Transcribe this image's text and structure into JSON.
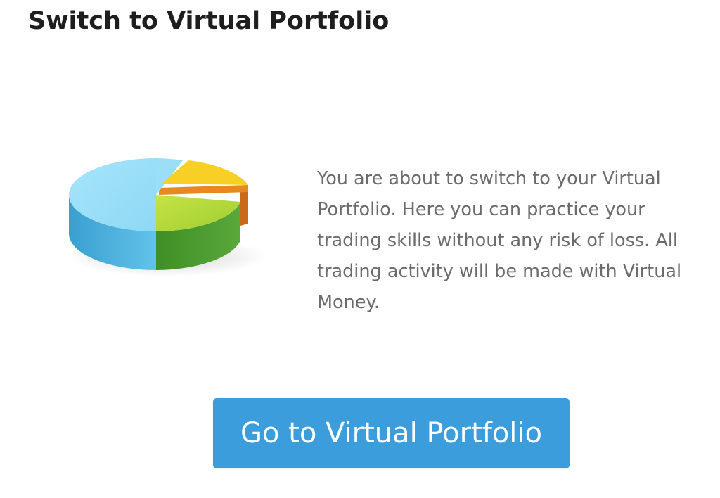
{
  "dialog": {
    "title": "Switch to Virtual Portfolio",
    "message": "You are about to switch to your Virtual Portfolio. Here you can practice your trading skills without any risk of loss. All trading activity will be made with Virtual Money.",
    "illustration_icon": "pie-chart-icon",
    "primary_button": {
      "label": "Go to Virtual Portfolio",
      "color": "#3b9ddb"
    }
  },
  "colors": {
    "title": "#1e1e1e",
    "body_text": "#6b6b6b",
    "button_text": "#ffffff"
  }
}
